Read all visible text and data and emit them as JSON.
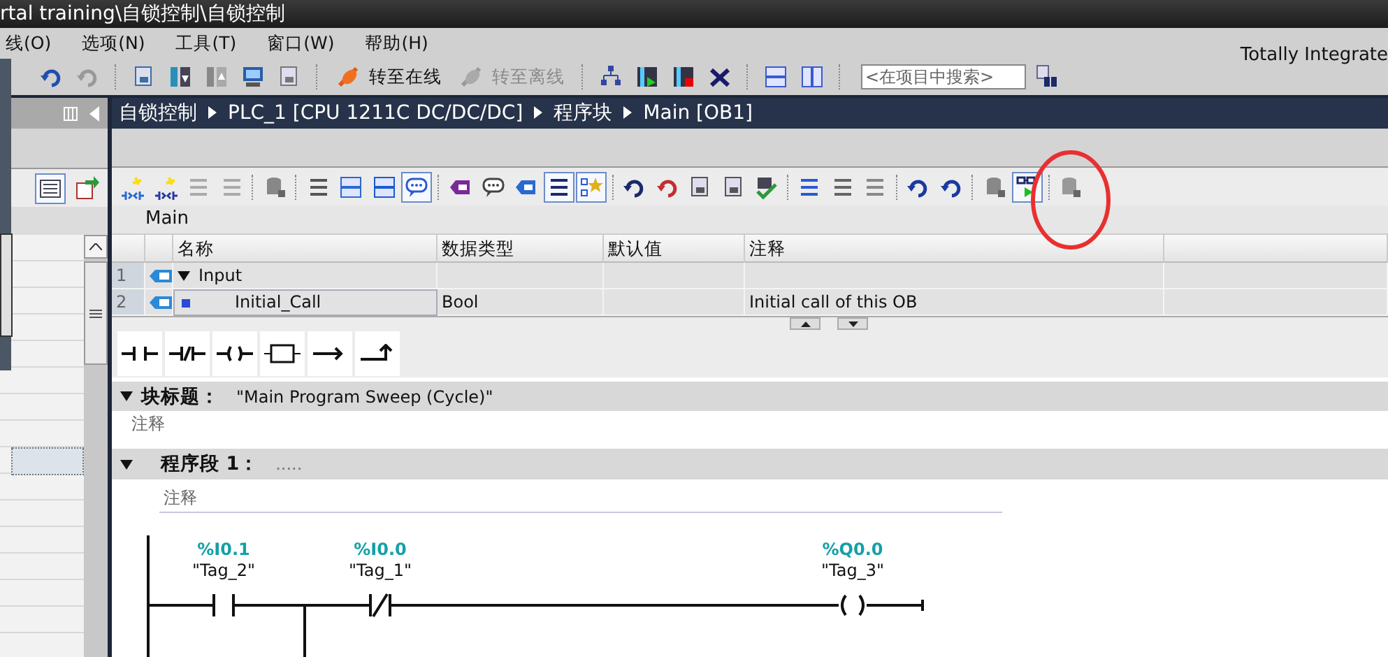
{
  "window": {
    "title": "rtal training\\自锁控制\\自锁控制",
    "brand": "Totally Integrate"
  },
  "menu": [
    "线(O)",
    "选项(N)",
    "工具(T)",
    "窗口(W)",
    "帮助(H)"
  ],
  "toolbar": {
    "buttons": [
      {
        "label": "转至在线",
        "disabled": false
      },
      {
        "label": "转至离线",
        "disabled": true
      }
    ],
    "search": {
      "placeholder": "<在项目中搜索>"
    }
  },
  "breadcrumb": [
    "自锁控制",
    "PLC_1 [CPU 1211C DC/DC/DC]",
    "程序块",
    "Main [OB1]"
  ],
  "editor": {
    "block_name": "Main",
    "interface": {
      "columns": [
        "名称",
        "数据类型",
        "默认值",
        "注释"
      ],
      "rows": [
        {
          "number": "1",
          "kind": "section",
          "name": "Input",
          "expanded": true
        },
        {
          "number": "2",
          "kind": "member",
          "name": "Initial_Call",
          "type": "Bool",
          "comment": "Initial call of this OB"
        }
      ]
    },
    "block_title": {
      "label": "块标题：",
      "value": "\"Main Program Sweep (Cycle)\"",
      "expanded": true,
      "comment": "注释"
    },
    "networks": [
      {
        "label": "程序段 1：",
        "title": ".....",
        "expanded": true,
        "comment": "注释",
        "elements": [
          {
            "kind": "no_contact",
            "address": "%I0.1",
            "tag": "\"Tag_2\""
          },
          {
            "kind": "nc_contact",
            "address": "%I0.0",
            "tag": "\"Tag_1\""
          },
          {
            "kind": "coil",
            "address": "%Q0.0",
            "tag": "\"Tag_3\""
          }
        ]
      }
    ]
  }
}
